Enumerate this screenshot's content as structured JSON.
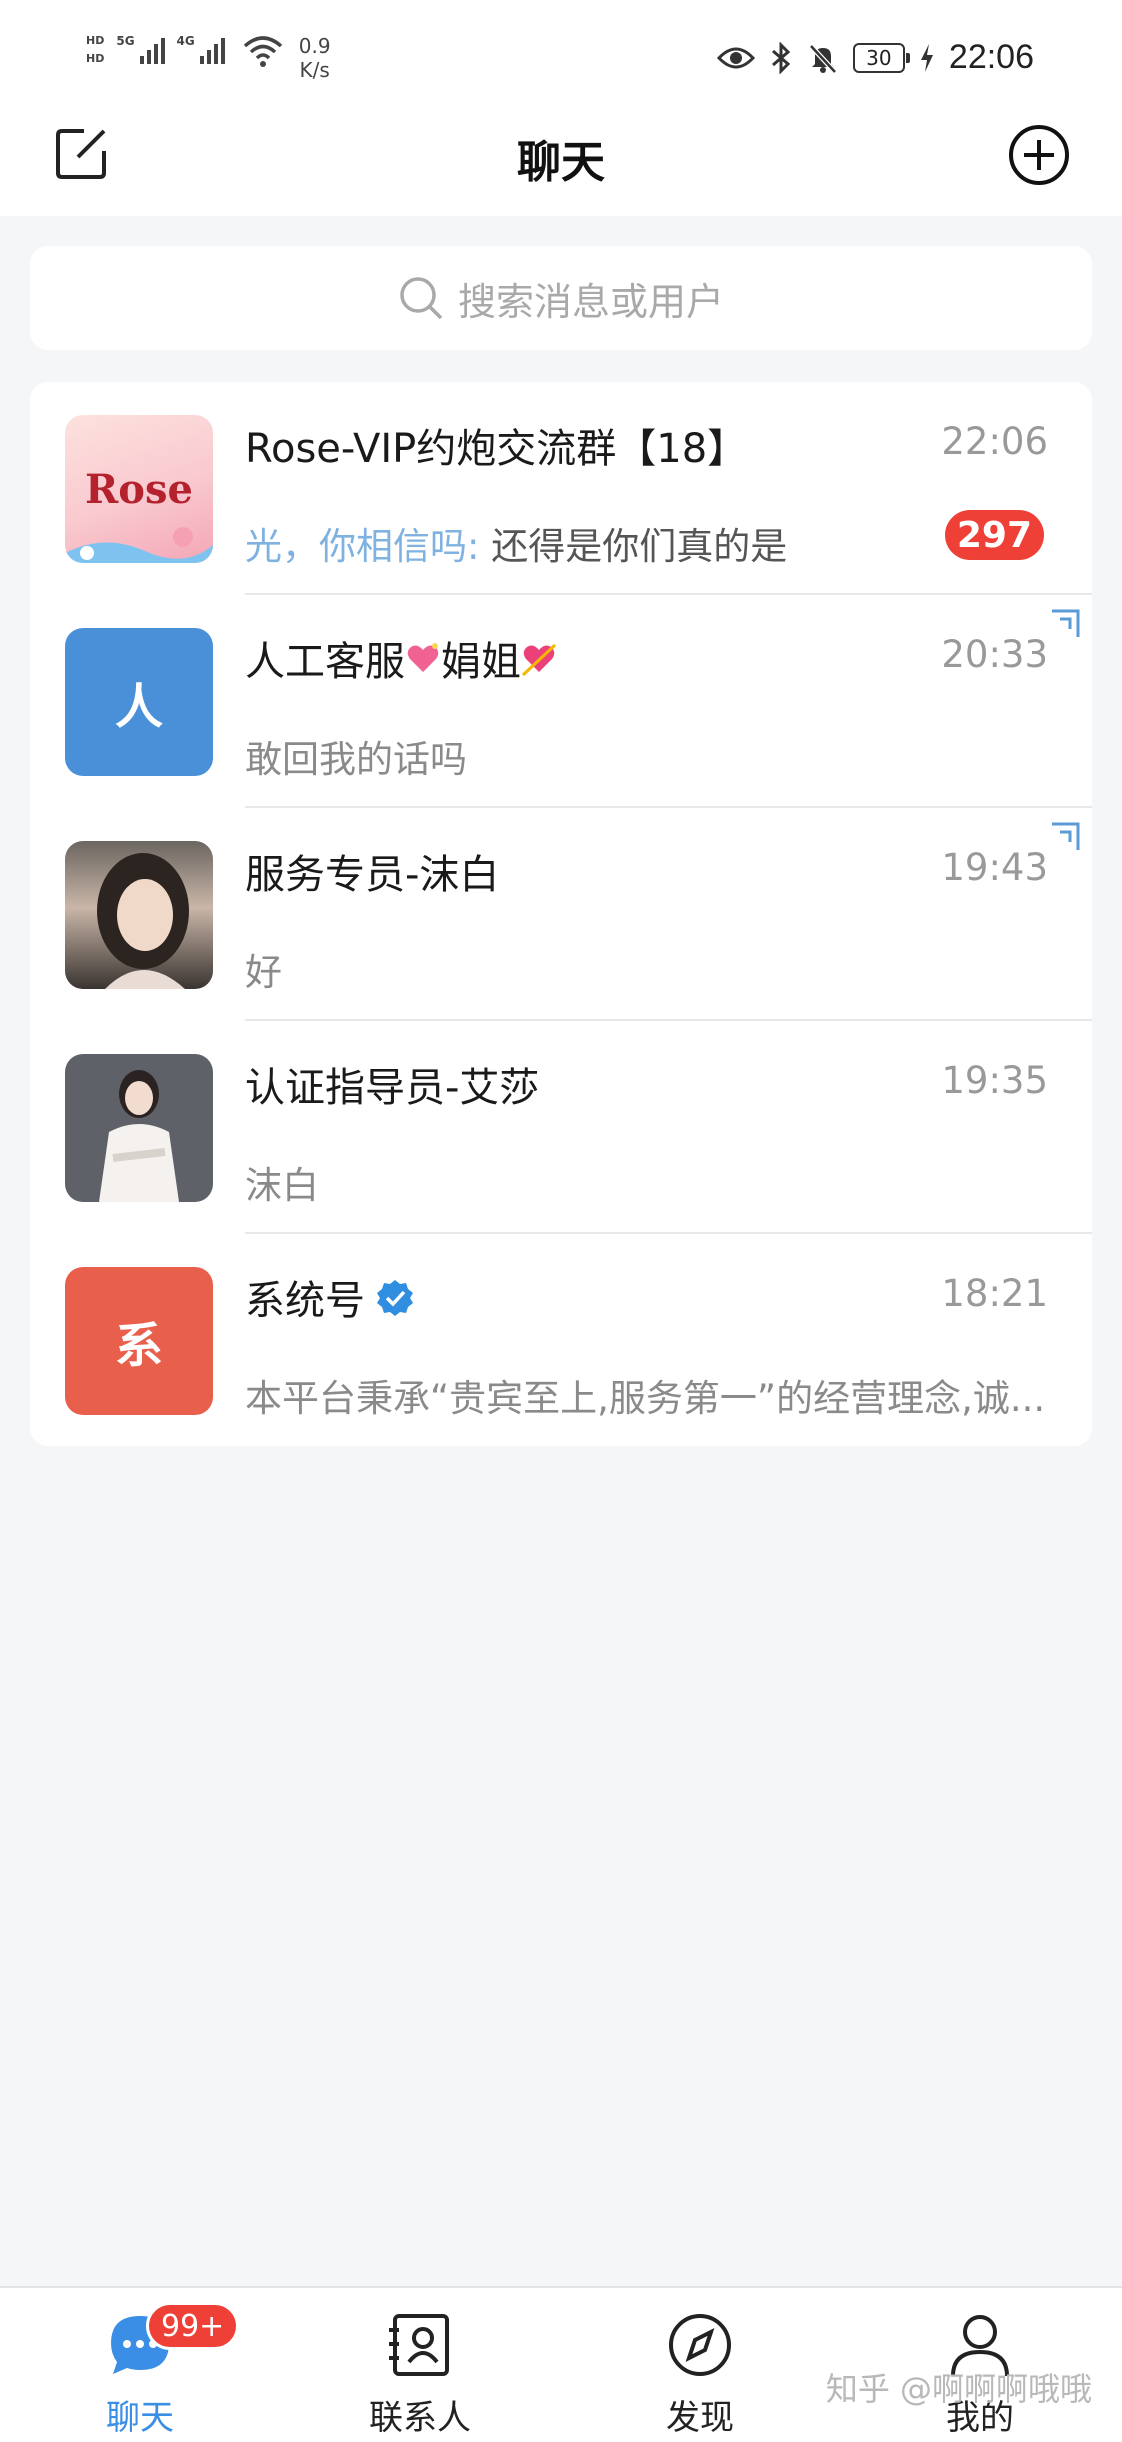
{
  "status_bar": {
    "hd_labels": [
      "HD",
      "HD"
    ],
    "network_labels": [
      "5G",
      "4G"
    ],
    "speed_value": "0.9",
    "speed_unit": "K/s",
    "battery": "30",
    "time": "22:06",
    "icons": [
      "eye-icon",
      "bluetooth-icon",
      "bell-muted-icon",
      "charging-icon"
    ]
  },
  "header": {
    "title": "聊天",
    "left_icon": "compose-icon",
    "right_icon": "add-circle-icon"
  },
  "search": {
    "placeholder": "搜索消息或用户"
  },
  "conversations": [
    {
      "name": "Rose-VIP约炮交流群【18】",
      "time": "22:06",
      "sender": "光，你相信吗:",
      "preview": " 还得是你们真的是",
      "unread": "297",
      "avatar_text": "Rose"
    },
    {
      "name": "人工客服",
      "name_suffix": "娟姐",
      "time": "20:33",
      "preview": "敢回我的话吗",
      "avatar_text": "人",
      "avatar_color": "#4a90d9"
    },
    {
      "name": "服务专员-沫白",
      "time": "19:43",
      "preview": "好"
    },
    {
      "name": "认证指导员-艾莎",
      "time": "19:35",
      "preview": "沫白"
    },
    {
      "name": "系统号",
      "time": "18:21",
      "preview": "本平台秉承“贵宾至上,服务第一”的经营理念,诚...",
      "avatar_text": "系",
      "avatar_color": "#e8604c"
    }
  ],
  "bottom_nav": {
    "items": [
      {
        "label": "聊天",
        "icon": "chat-bubble-icon",
        "active": true
      },
      {
        "label": "联系人",
        "icon": "contacts-icon",
        "active": false
      },
      {
        "label": "发现",
        "icon": "compass-icon",
        "active": false
      },
      {
        "label": "我的",
        "icon": "person-icon",
        "active": false
      }
    ],
    "chat_badge": "99+"
  },
  "watermark": "知乎 @啊啊啊哦哦",
  "colors": {
    "accent": "#3a8ee6",
    "badge_red": "#ee4037",
    "background": "#f5f6f8"
  }
}
